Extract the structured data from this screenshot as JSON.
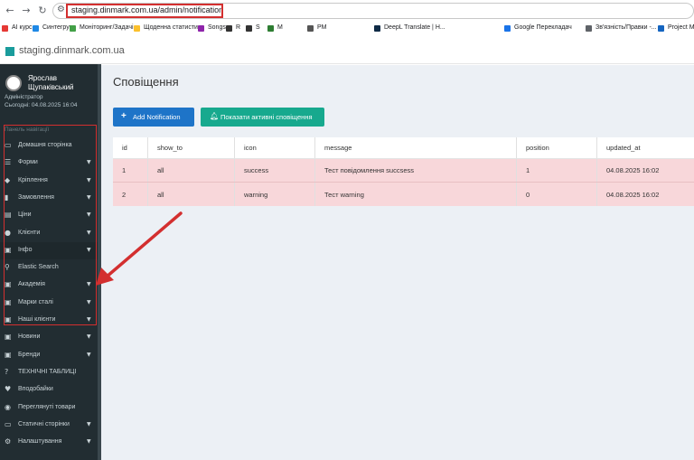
{
  "browser": {
    "url": "staging.dinmark.com.ua/admin/notification",
    "bookmarks": [
      {
        "label": "AI курс",
        "color": "#e53935"
      },
      {
        "label": "Синтегрум",
        "color": "#1e88e5"
      },
      {
        "label": "Моніторинг/Задачі",
        "color": "#43a047"
      },
      {
        "label": "Щоденна статистика",
        "color": "#fbc02d"
      },
      {
        "label": "Songs",
        "color": "#8e24aa"
      },
      {
        "label": "R",
        "color": "#333333"
      },
      {
        "label": "S",
        "color": "#333333"
      },
      {
        "label": "M",
        "color": "#2e7d32"
      },
      {
        "label": "PM",
        "color": "#555555"
      },
      {
        "label": "DeepL Translate | H...",
        "color": "#0f2b46"
      },
      {
        "label": "Google Перекладач",
        "color": "#1a73e8"
      },
      {
        "label": "Зв'язність/Правки -...",
        "color": "#5f6368"
      },
      {
        "label": "Project M",
        "color": "#1565c0"
      }
    ]
  },
  "site": {
    "name": "staging.dinmark.com.ua"
  },
  "sidebar": {
    "user_name": "Ярослав Щупаківський",
    "user_role": "Адміністратор",
    "user_date": "Сьогодні: 04.08.2025 16:04",
    "nav_header": "Панель навігації",
    "items": [
      {
        "label": "Домашня сторінка",
        "icon": "laptop-icon",
        "glyph": "▭",
        "has_caret": false
      },
      {
        "label": "Форми",
        "icon": "list-icon",
        "glyph": "☰",
        "has_caret": true
      },
      {
        "label": "Кріплення",
        "icon": "cubes-icon",
        "glyph": "◆",
        "has_caret": true
      },
      {
        "label": "Замовлення",
        "icon": "chart-icon",
        "glyph": "▮",
        "has_caret": true
      },
      {
        "label": "Ціни",
        "icon": "price-icon",
        "glyph": "▤",
        "has_caret": true
      },
      {
        "label": "Клієнти",
        "icon": "users-icon",
        "glyph": "●",
        "has_caret": true
      },
      {
        "label": "Інфо",
        "icon": "book-icon",
        "glyph": "▣",
        "has_caret": true
      },
      {
        "label": "Elastic Search",
        "icon": "search-icon",
        "glyph": "⚲",
        "has_caret": false
      },
      {
        "label": "Академія",
        "icon": "book-icon",
        "glyph": "▣",
        "has_caret": true
      },
      {
        "label": "Марки сталі",
        "icon": "book-icon",
        "glyph": "▣",
        "has_caret": true
      },
      {
        "label": "Наші клієнти",
        "icon": "book-icon",
        "glyph": "▣",
        "has_caret": true
      },
      {
        "label": "Новини",
        "icon": "book-icon",
        "glyph": "▣",
        "has_caret": true
      },
      {
        "label": "Бренди",
        "icon": "book-icon",
        "glyph": "▣",
        "has_caret": true
      },
      {
        "label": "ТЕХНІЧНІ ТАБЛИЦІ",
        "icon": "question-icon",
        "glyph": "?",
        "has_caret": false
      },
      {
        "label": "Вподобайки",
        "icon": "heart-icon",
        "glyph": "♥",
        "has_caret": false
      },
      {
        "label": "Переглянуті товари",
        "icon": "eye-icon",
        "glyph": "◉",
        "has_caret": false
      },
      {
        "label": "Статичні сторінки",
        "icon": "laptop-icon",
        "glyph": "▭",
        "has_caret": true
      },
      {
        "label": "Налаштування",
        "icon": "cogs-icon",
        "glyph": "⚙",
        "has_caret": true
      }
    ],
    "active_index": 6
  },
  "main": {
    "title": "Сповіщення",
    "add_button": "Add Notification",
    "show_button": "Показати активні сповіщення",
    "table": {
      "columns": [
        "id",
        "show_to",
        "icon",
        "message",
        "position",
        "updated_at"
      ],
      "rows": [
        [
          "1",
          "all",
          "success",
          "Тест повідомлення succsess",
          "1",
          "04.08.2025 16:02"
        ],
        [
          "2",
          "all",
          "warning",
          "Тест warning",
          "0",
          "04.08.2025 16:02"
        ]
      ]
    }
  },
  "colors": {
    "sidebar_bg": "#222d32",
    "primary": "#1e74c8",
    "teal": "#17a98e",
    "row_highlight": "#f8d7da",
    "annotation_red": "#d32f2f"
  }
}
